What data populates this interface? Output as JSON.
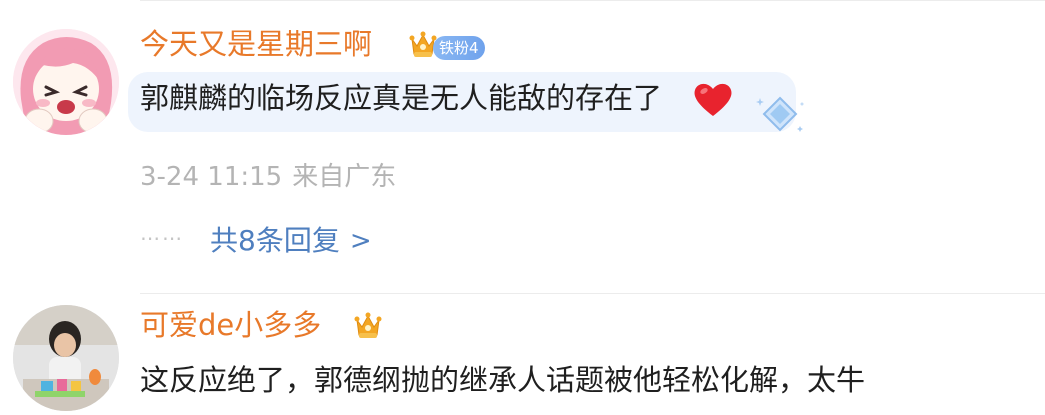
{
  "comments": [
    {
      "username": "今天又是星期三啊",
      "fan_badge": "铁粉4",
      "text": "郭麒麟的临场反应真是无人能敌的存在了",
      "time": "3-24 11:15",
      "location": "来自广东",
      "replies_label": "共8条回复",
      "replies_arrow": ">",
      "replies_dots": "⋯⋯"
    },
    {
      "username": "可爱de小多多",
      "text": "这反应绝了，郭德纲抛的继承人话题被他轻松化解，太牛"
    }
  ],
  "icons": {
    "crown": "crown-icon",
    "heart": "heart-emoji-icon",
    "diamond": "diamond-sparkle-icon"
  },
  "colors": {
    "username": "#e8792a",
    "link": "#4f7fbf",
    "meta": "#b4b4b4",
    "bubble": "#eef4fd",
    "fan_badge": "#7aaaf0",
    "heart": "#e8232e"
  }
}
